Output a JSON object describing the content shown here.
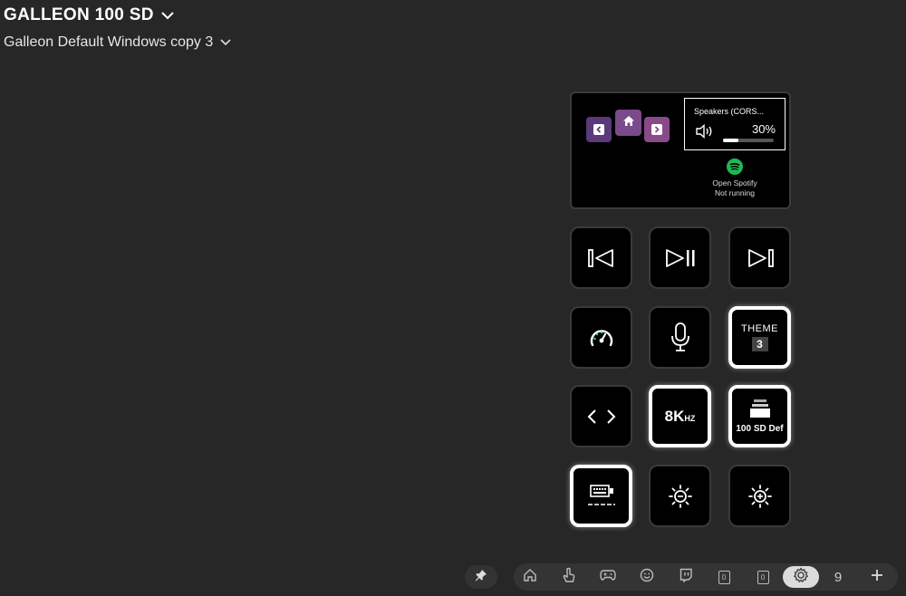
{
  "header": {
    "device_name": "GALLEON 100 SD",
    "profile_name": "Galleon Default Windows copy 3"
  },
  "lcd": {
    "volume": {
      "device_label": "Speakers (CORS...",
      "percent_label": "30%",
      "level": 0.3
    },
    "spotify": {
      "line1": "Open Spotify",
      "line2": "Not running",
      "icon": "spotify-icon"
    },
    "nav_icons": [
      "chevron-left-icon",
      "home-icon",
      "chevron-right-icon"
    ]
  },
  "keys": [
    {
      "icon": "previous-track-icon"
    },
    {
      "icon": "play-pause-icon"
    },
    {
      "icon": "next-track-icon"
    },
    {
      "icon": "performance-gauge-icon"
    },
    {
      "icon": "microphone-icon"
    },
    {
      "icon": "theme-icon",
      "label": "THEME",
      "value": "3"
    },
    {
      "icon": "code-brackets-icon"
    },
    {
      "icon": "polling-rate-icon",
      "label_big": "8K",
      "label_small": "HZ"
    },
    {
      "icon": "device-profile-icon",
      "label": "100 SD Def"
    },
    {
      "icon": "keyboard-icon"
    },
    {
      "icon": "brightness-down-icon"
    },
    {
      "icon": "brightness-up-icon"
    }
  ],
  "page_bar": {
    "icons": [
      "home-icon",
      "hand-pointer-icon",
      "gamepad-icon",
      "smiley-icon",
      "twitch-icon",
      "page-box-icon",
      "page-box-icon",
      "settings-gear-icon"
    ],
    "box_label_1": "0",
    "box_label_2": "0",
    "page_number": "9",
    "active_index": 7
  },
  "colors": {
    "background": "#272727",
    "lcd_nav_purple": "#7a4a8a",
    "spotify_green": "#1db954"
  }
}
